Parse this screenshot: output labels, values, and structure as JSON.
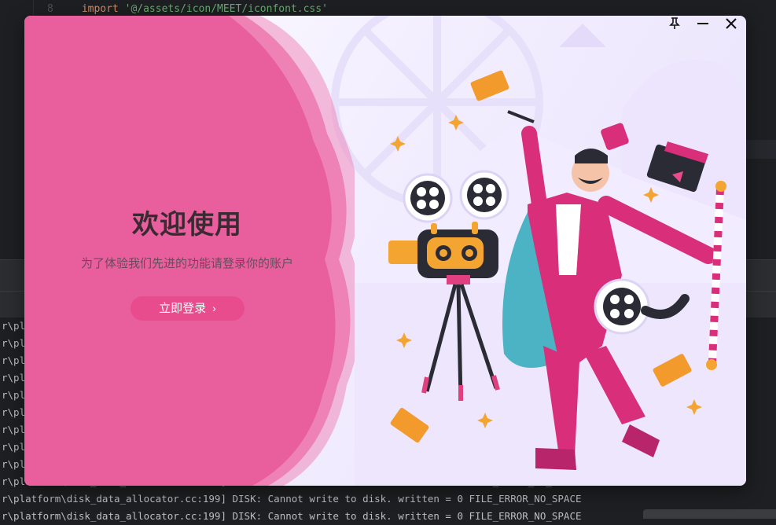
{
  "ide": {
    "line_number": "8",
    "code_keyword": "import",
    "code_string": "'@/assets/icon/MEET/iconfont.css'",
    "console_lines": [
      "r\\pl",
      "r\\pl",
      "r\\pl",
      "r\\pl",
      "r\\pl",
      "r\\pl",
      "r\\pl",
      "r\\pl",
      "r\\pl",
      "r\\platform\\disk_data_allocator.cc:199] DISK: Cannot write to disk. written = 0 FILE_ERROR_NO_SPACE",
      "r\\platform\\disk_data_allocator.cc:199] DISK: Cannot write to disk. written = 0 FILE_ERROR_NO_SPACE",
      "r\\platform\\disk_data_allocator.cc:199] DISK: Cannot write to disk. written = 0 FILE_ERROR_NO_SPACE"
    ]
  },
  "dialog": {
    "title": "欢迎使用",
    "subtitle": "为了体验我们先进的功能请登录你的账户",
    "login_label": "立即登录",
    "login_chevron": "›",
    "controls": {
      "pin": "pin-icon",
      "minimize": "minimize-icon",
      "close": "close-icon"
    }
  },
  "colors": {
    "accent": "#e84c8c",
    "blob": "#ec6fa8",
    "ide_bg": "#1e1f22"
  }
}
